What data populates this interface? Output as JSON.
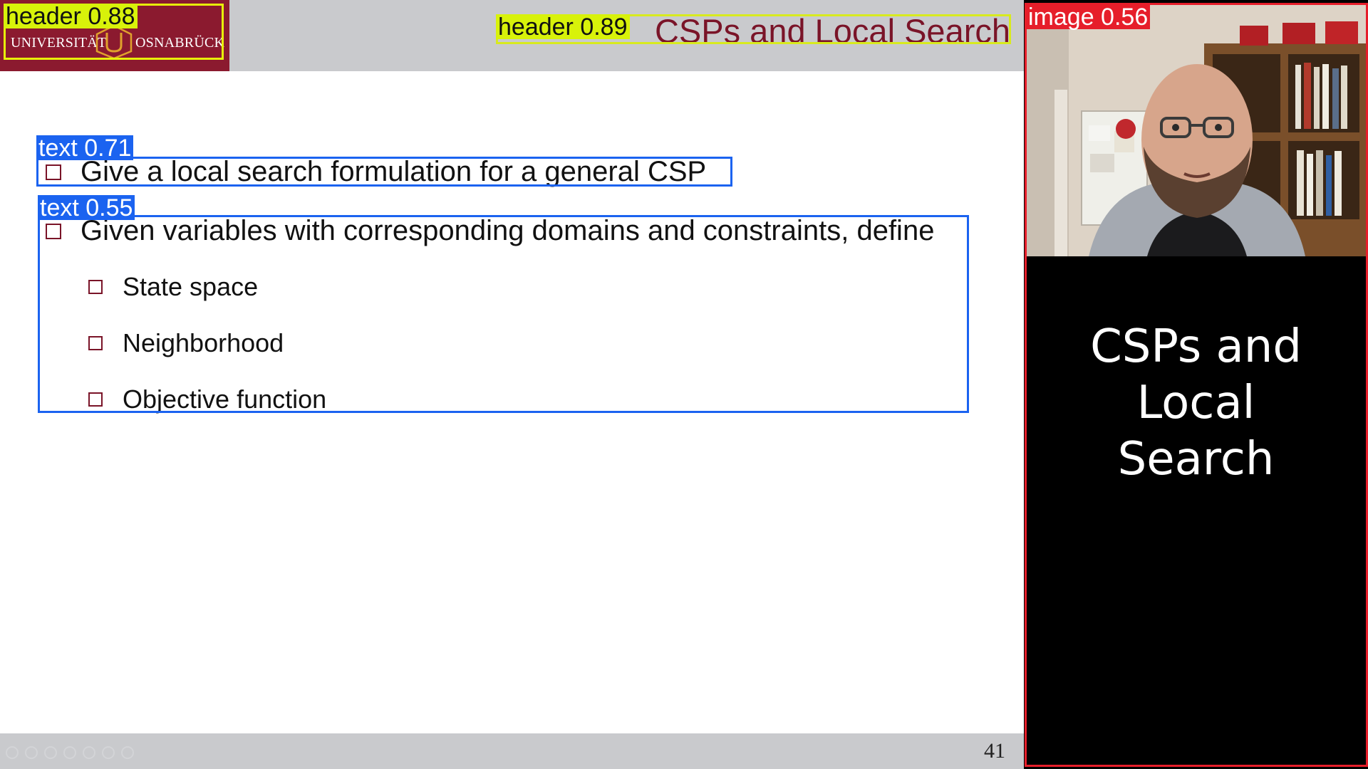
{
  "university": {
    "left_word": "UNIVERSITÄT",
    "right_word": "OSNABRÜCK",
    "brand_color": "#8b1a2f"
  },
  "slide": {
    "title": "CSPs and Local Search",
    "title_color": "#7a1428",
    "bullets": [
      {
        "text": "Give a local search formulation for a general CSP"
      },
      {
        "text": "Given variables with corresponding domains and constraints, define"
      }
    ],
    "sub_bullets": [
      {
        "text": "State space"
      },
      {
        "text": "Neighborhood"
      },
      {
        "text": "Objective function"
      }
    ],
    "page_number": "41"
  },
  "detections": {
    "header_logo": "header 0.88",
    "header_title": "header 0.89",
    "text_1": "text 0.71",
    "text_2": "text 0.55",
    "image": "image 0.56"
  },
  "side_panel": {
    "title_lines": [
      "CSPs and",
      "Local",
      "Search"
    ]
  },
  "icons": {
    "bullet": "checkbox-bullet-icon",
    "seal": "university-seal-icon"
  }
}
